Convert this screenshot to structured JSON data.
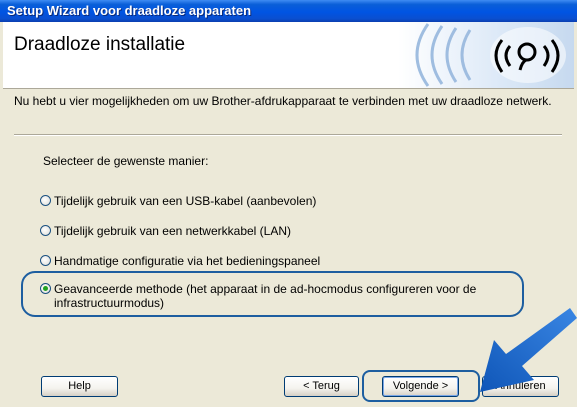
{
  "window": {
    "title": "Setup Wizard voor draadloze apparaten"
  },
  "header": {
    "title": "Draadloze installatie",
    "icon": "wifi-signal-icon"
  },
  "intro": "Nu hebt u vier mogelijkheden om uw Brother-afdrukapparaat te verbinden met uw draadloze netwerk.",
  "prompt": "Selecteer de gewenste manier:",
  "options": [
    {
      "label": "Tijdelijk gebruik van een USB-kabel (aanbevolen)",
      "selected": false
    },
    {
      "label": "Tijdelijk gebruik van een netwerkkabel (LAN)",
      "selected": false
    },
    {
      "label": "Handmatige configuratie via het bedieningspaneel",
      "selected": false
    },
    {
      "label": "Geavanceerde methode (het apparaat in de ad-hocmodus configureren voor de infrastructuurmodus)",
      "selected": true
    }
  ],
  "buttons": {
    "help": "Help",
    "back": "< Terug",
    "next": "Volgende >",
    "cancel": "Annuleren"
  },
  "colors": {
    "title_bar": "#0054e3",
    "dialog_bg": "#ece9d8",
    "highlight": "#1d5ea0",
    "arrow": "#1f6fd6"
  }
}
